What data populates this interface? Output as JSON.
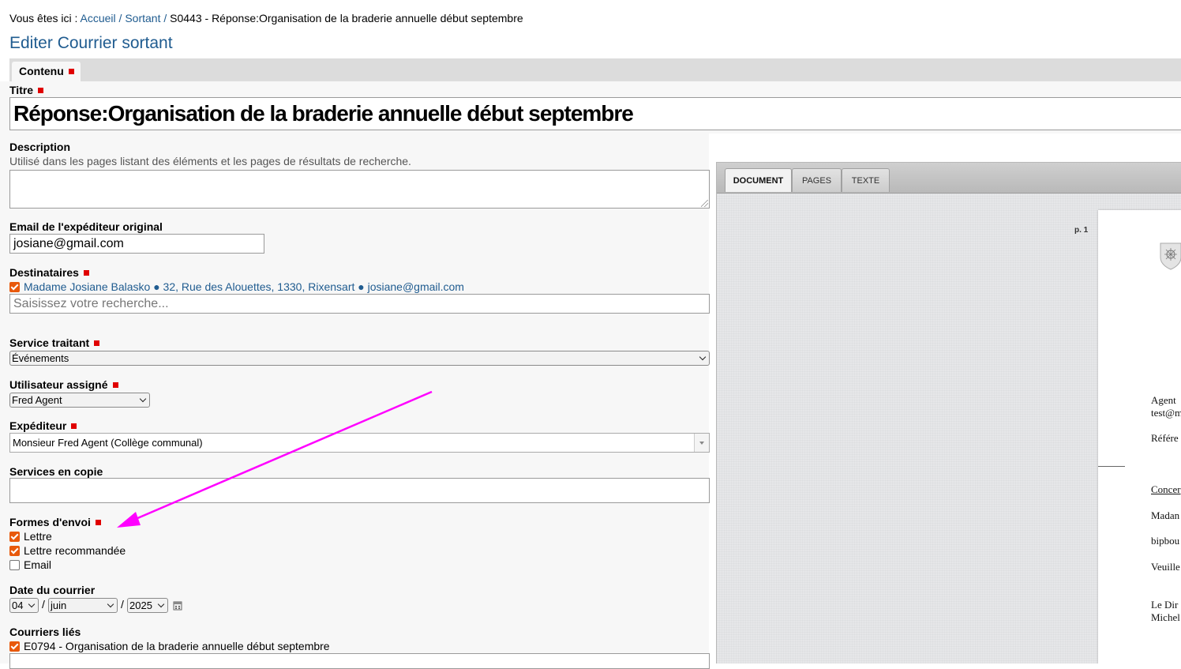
{
  "breadcrumb": {
    "prefix": "Vous êtes ici :",
    "home": "Accueil",
    "section": "Sortant",
    "current": "S0443 - Réponse:Organisation de la braderie annuelle début septembre"
  },
  "page_title": "Editer Courrier sortant",
  "tabs": {
    "active": "Contenu"
  },
  "form": {
    "titre_label": "Titre",
    "titre_value": "Réponse:Organisation de la braderie annuelle début septembre",
    "description_label": "Description",
    "description_help": "Utilisé dans les pages listant des éléments et les pages de résultats de recherche.",
    "email_label": "Email de l'expéditeur original",
    "email_value": "josiane@gmail.com",
    "destinataires_label": "Destinataires",
    "destinataire_item": "Madame Josiane Balasko ● 32, Rue des Alouettes, 1330, Rixensart ● josiane@gmail.com",
    "search_placeholder": "Saisissez votre recherche...",
    "service_label": "Service traitant",
    "service_value": "Événements",
    "utilisateur_label": "Utilisateur assigné",
    "utilisateur_value": "Fred Agent",
    "expediteur_label": "Expéditeur",
    "expediteur_value": "Monsieur Fred Agent (Collège communal)",
    "copie_label": "Services en copie",
    "formes_label": "Formes d'envoi",
    "formes": [
      {
        "label": "Lettre",
        "checked": true
      },
      {
        "label": "Lettre recommandée",
        "checked": true
      },
      {
        "label": "Email",
        "checked": false
      }
    ],
    "date_label": "Date du courrier",
    "date_day": "04",
    "date_month": "juin",
    "date_year": "2025",
    "date_sep": "/",
    "lies_label": "Courriers liés",
    "lies_item": "E0794 - Organisation de la braderie annuelle début septembre"
  },
  "viewer": {
    "tabs": [
      "DOCUMENT",
      "PAGES",
      "TEXTE"
    ],
    "page_number": "p. 1",
    "snippets": [
      "Agent",
      "test@m",
      "Référe",
      "Concer",
      "Madan",
      "bipbou",
      "Veuille",
      "Le Dir",
      "Michel"
    ]
  },
  "colors": {
    "link": "#205c90",
    "required": "#e00000",
    "checkbox": "#e8590c",
    "annotation_arrow": "#ff00ff"
  }
}
